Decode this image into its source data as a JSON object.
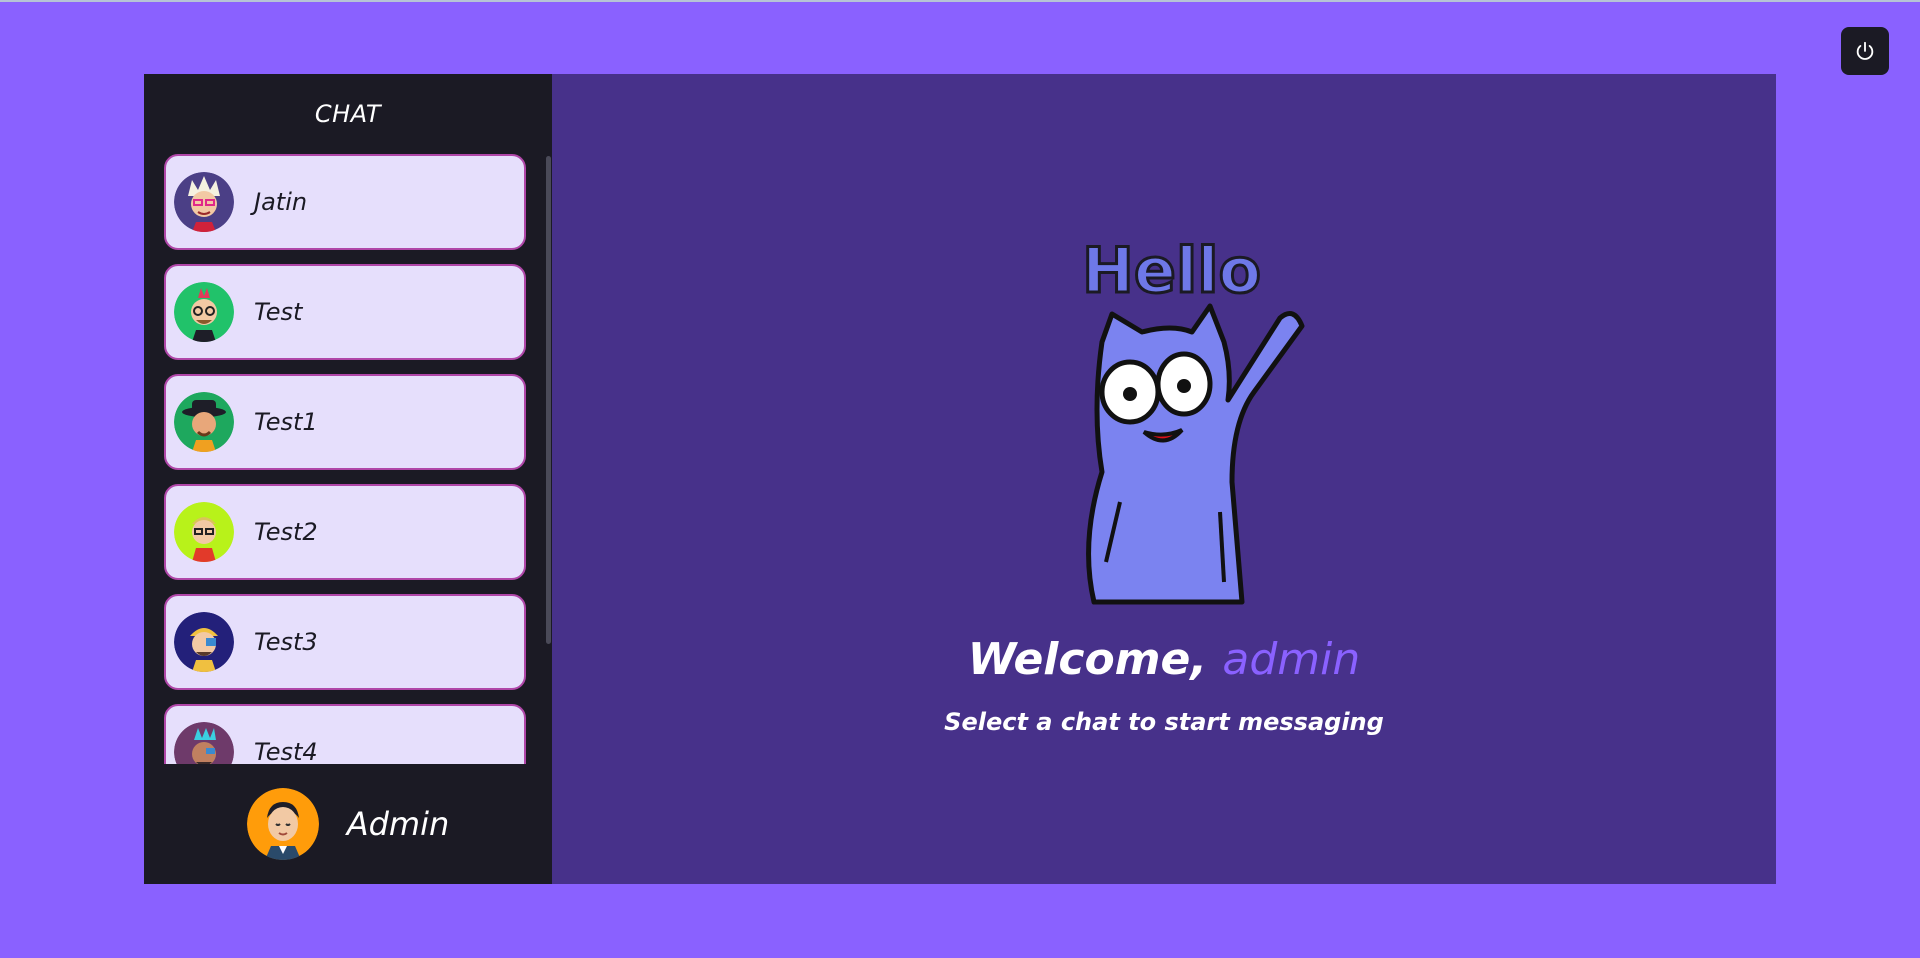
{
  "header": {
    "power_icon": "power-icon"
  },
  "sidebar": {
    "title": "CHAT",
    "contacts": [
      {
        "name": "Jatin",
        "avatar_bg": "#4b3f86"
      },
      {
        "name": "Test",
        "avatar_bg": "#21c26a"
      },
      {
        "name": "Test1",
        "avatar_bg": "#1ea85e"
      },
      {
        "name": "Test2",
        "avatar_bg": "#b8f21a"
      },
      {
        "name": "Test3",
        "avatar_bg": "#23207a"
      },
      {
        "name": "Test4",
        "avatar_bg": "#6e3a6a"
      }
    ],
    "current_user": {
      "name": "Admin",
      "avatar_bg": "#ff9c0a"
    }
  },
  "main": {
    "hello_text": "Hello",
    "welcome_prefix": "Welcome, ",
    "welcome_user": "admin",
    "subtitle": "Select a chat to start messaging"
  },
  "colors": {
    "page_bg": "#8a61ff",
    "sidebar_bg": "#1b1a24",
    "main_bg": "#47318a",
    "contact_bg": "#e6dffc",
    "contact_border": "#b046a8"
  }
}
